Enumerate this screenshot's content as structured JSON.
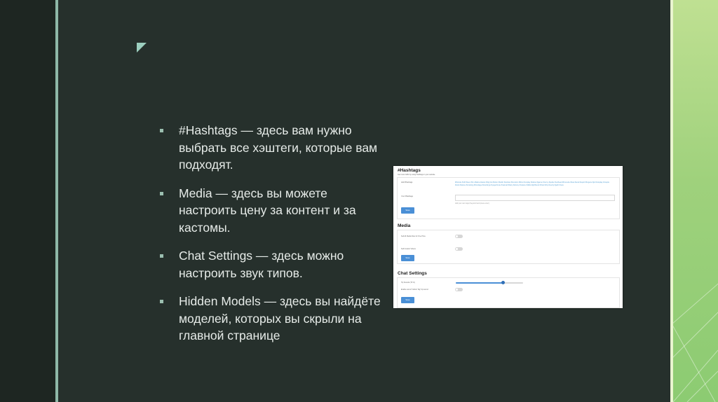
{
  "bullets": [
    "#Hashtags — здесь вам нужно выбрать все хэштеги, которые вам подходят.",
    "Media — здесь вы можете настроить цену за контент и за кастомы.",
    "Chat Settings — здесь можно настроить звук типов.",
    "Hidden Models — здесь вы найдёте моделей, которых вы скрыли на главной странице"
  ],
  "screenshot": {
    "hashtags": {
      "title": "#Hashtags",
      "subtitle": "Get more traffic by using Hashtags in your website",
      "add_label": "Add #Hashtags",
      "your_label": "Your #Hashtags",
      "tags_text": "#blonde #milf #teen #fun #latina #asian #big tits #bdsm #fetish #lesbian #femdom #bbw #cosplay #tattoo #gamer #curvy #petite #redhead #brunette #feet #anal #squirt #lingerie #joi #roleplay #couple #solo #dance #smoking #bondage #stockings #yoga #cute #natural #hairy #ebony #mature #dildo #girlfriend #chat #shy #nerdy #goth #new",
      "hint": "Add your own tags (Keyword and press enter)",
      "save": "Save"
    },
    "media": {
      "title": "Media",
      "row1": "Sell All Media Files for One Price",
      "row2": "Sell Custom Videos",
      "save": "Save"
    },
    "chat": {
      "title": "Chat Settings",
      "row1": "Tip Sounds (70 %)",
      "row2": "Enable sound \"Admin Tag\" tip sound",
      "volume": 0.7,
      "save": "Save"
    }
  },
  "colors": {
    "accent": "#4a8fd6",
    "tag_link": "#5aa3d6",
    "right_panel": "#9fd17c"
  },
  "icons": {
    "corner_mark": "corner-triangle-icon",
    "bullet": "square-bullet-icon"
  }
}
